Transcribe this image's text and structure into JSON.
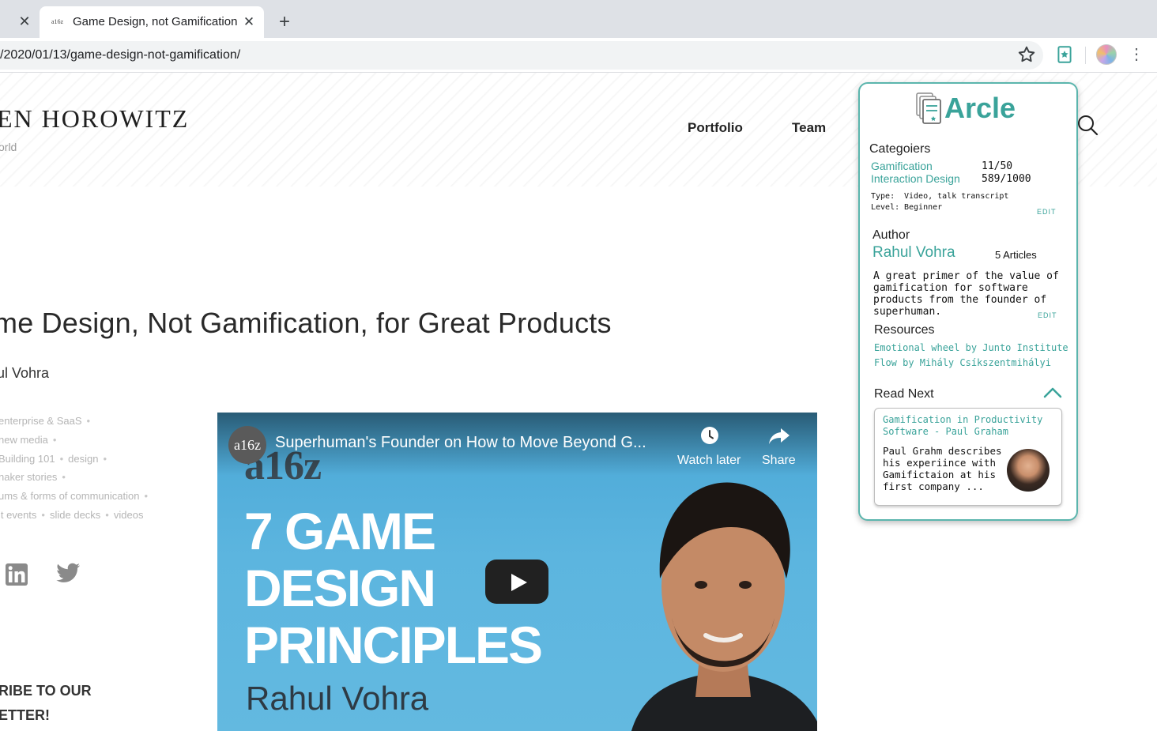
{
  "browser": {
    "tab_title": "Game Design, not Gamification",
    "tab_favicon": "a16z",
    "url": "/2020/01/13/game-design-not-gamification/",
    "close_glyph": "✕",
    "new_tab_glyph": "+",
    "menu_glyph": "⋮"
  },
  "site": {
    "logo": "EN HOROWITZ",
    "logo_sub": "orld",
    "nav": {
      "portfolio": "Portfolio",
      "team": "Team"
    }
  },
  "article": {
    "title": "me Design, Not Gamification, for Great Products",
    "author": "ul Vohra",
    "tags": [
      [
        "enterprise & SaaS"
      ],
      [
        "new media"
      ],
      [
        "Building 101",
        "design"
      ],
      [
        "naker stories"
      ],
      [
        "ums & forms of communication"
      ],
      [
        "it events",
        "slide decks",
        "videos"
      ]
    ],
    "subscribe_line1": "RIBE TO OUR",
    "subscribe_line2": "ETTER!"
  },
  "video": {
    "channel": "a16z",
    "title": "Superhuman's Founder on How to Move Beyond G...",
    "watch_later": "Watch later",
    "share": "Share",
    "brand": "a16z",
    "line1": "7 GAME",
    "line2": "DESIGN",
    "line3": "PRINCIPLES",
    "speaker": "Rahul Vohra"
  },
  "arcle": {
    "title": "Arcle",
    "categories_head": "Categoiers",
    "categories": [
      {
        "name": "Gamification",
        "score": "11/50"
      },
      {
        "name": "Interaction Design",
        "score": "589/1000"
      }
    ],
    "type_label": "Type:",
    "type_value": "Video, talk transcript",
    "level_label": "Level:",
    "level_value": "Beginner",
    "edit": "EDIT",
    "author_head": "Author",
    "author_name": "Rahul Vohra",
    "author_count": "5 Articles",
    "author_desc": "A great primer of the value of gamification for software products from the founder of superhuman.",
    "resources_head": "Resources",
    "resources": [
      "Emotional wheel by Junto Institute",
      "Flow by Mihály Csíkszentmihályi"
    ],
    "readnext_head": "Read Next",
    "readnext_title": "Gamification in Productivity Software - Paul Graham",
    "readnext_desc": "Paul Grahm describes his experiince with Gamifictaion at his first company ...",
    "accent": "#3aa39a"
  }
}
